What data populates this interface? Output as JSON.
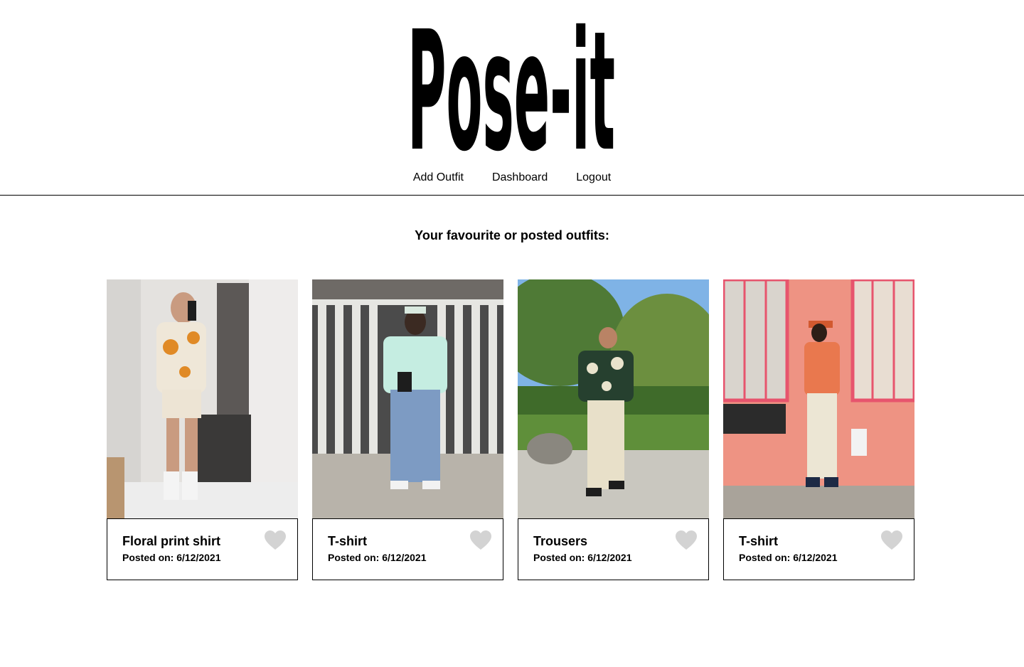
{
  "brand": {
    "name": "Pose-it"
  },
  "nav": {
    "items": [
      {
        "label": "Add Outfit"
      },
      {
        "label": "Dashboard"
      },
      {
        "label": "Logout"
      }
    ]
  },
  "main": {
    "heading": "Your favourite or posted outfits:"
  },
  "outfits": [
    {
      "title": "Floral print shirt",
      "posted": "Posted on: 6/12/2021",
      "favourite_icon": "heart-icon"
    },
    {
      "title": "T-shirt",
      "posted": "Posted on: 6/12/2021",
      "favourite_icon": "heart-icon"
    },
    {
      "title": "Trousers",
      "posted": "Posted on: 6/12/2021",
      "favourite_icon": "heart-icon"
    },
    {
      "title": "T-shirt",
      "posted": "Posted on: 6/12/2021",
      "favourite_icon": "heart-icon"
    }
  ],
  "colors": {
    "heart": "#d3d3d3",
    "border": "#000000",
    "background": "#ffffff"
  }
}
